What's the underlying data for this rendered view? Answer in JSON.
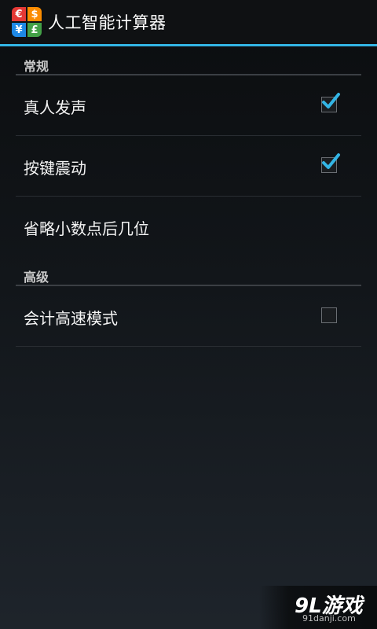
{
  "app": {
    "title": "人工智能计算器",
    "icon_symbols": [
      "€",
      "$",
      "¥",
      "£"
    ]
  },
  "sections": [
    {
      "header": "常规",
      "items": [
        {
          "label": "真人发声",
          "checkbox": true,
          "checked": true
        },
        {
          "label": "按键震动",
          "checkbox": true,
          "checked": true
        },
        {
          "label": "省略小数点后几位",
          "checkbox": false
        }
      ]
    },
    {
      "header": "高级",
      "items": [
        {
          "label": "会计高速模式",
          "checkbox": true,
          "checked": false
        }
      ]
    }
  ],
  "watermark": {
    "logo": "9L游戏",
    "url": "91danji.com"
  },
  "colors": {
    "accent": "#33b5e5",
    "background": "#0b0d0f"
  }
}
